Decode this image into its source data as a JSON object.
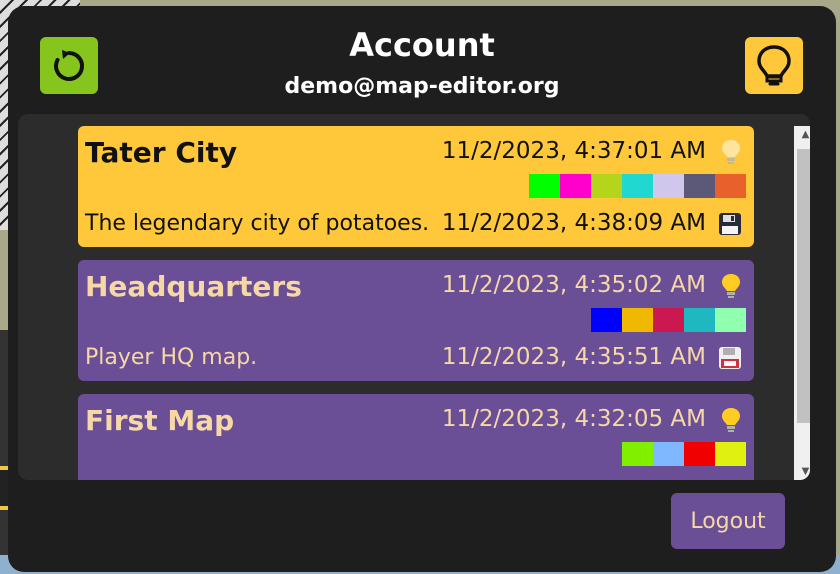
{
  "header": {
    "title": "Account",
    "email": "demo@map-editor.org",
    "refresh_icon": "refresh-icon",
    "idea_icon": "lightbulb-icon"
  },
  "maps": [
    {
      "name": "Tater City",
      "created": "11/2/2023, 4:37:01 AM",
      "modified": "11/2/2023, 4:38:09 AM",
      "description": "The legendary city of potatoes.",
      "bg_color": "#ffc83a",
      "text_color": "#111111",
      "palette": [
        "#00ff00",
        "#ff00cc",
        "#b5d41c",
        "#20d8d0",
        "#d0c8ec",
        "#5c5878",
        "#e8602c"
      ]
    },
    {
      "name": "Headquarters",
      "created": "11/2/2023, 4:35:02 AM",
      "modified": "11/2/2023, 4:35:51 AM",
      "description": "Player HQ map.",
      "bg_color": "#6b4f96",
      "text_color": "#f6d8a6",
      "palette": [
        "#0000ff",
        "#f0b800",
        "#cc1850",
        "#20b8c0",
        "#90ffb0"
      ]
    },
    {
      "name": "First Map",
      "created": "11/2/2023, 4:32:05 AM",
      "modified": "",
      "description": "",
      "bg_color": "#6b4f96",
      "text_color": "#f6d8a6",
      "palette": [
        "#80f000",
        "#80b8ff",
        "#f00000",
        "#e0f010"
      ]
    }
  ],
  "footer": {
    "logout_label": "Logout"
  },
  "colors": {
    "refresh_bg": "#86c51d",
    "idea_bg": "#ffc83a",
    "modal_bg": "#1e1e1e"
  }
}
